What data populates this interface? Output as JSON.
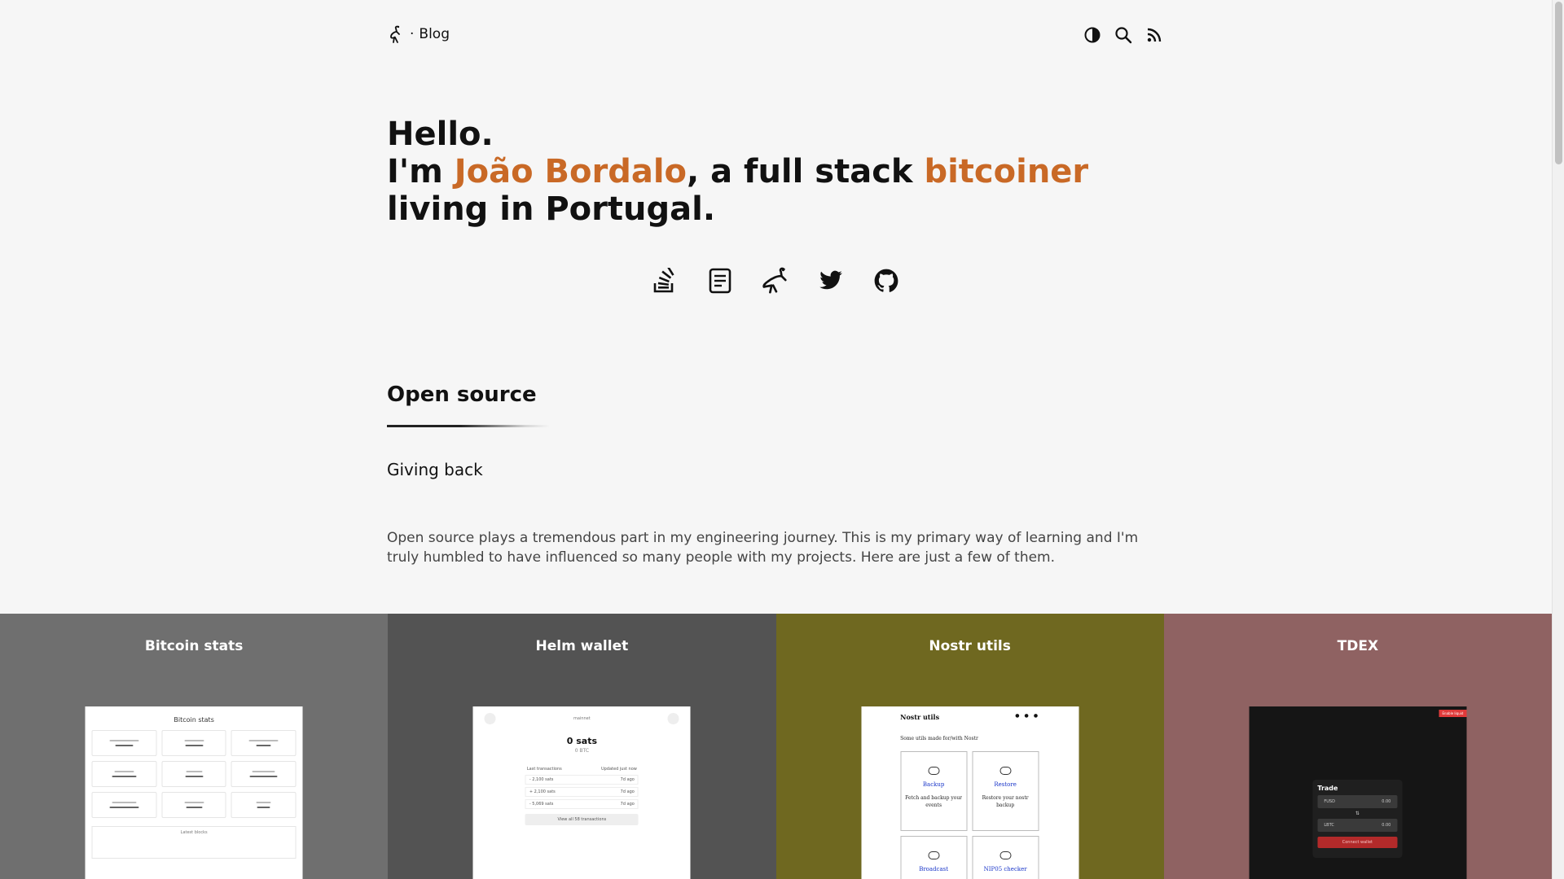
{
  "header": {
    "brand_logo_icon": "ostrich-mark-icon",
    "brand_separator": "·",
    "brand_label": "Blog",
    "actions": [
      {
        "icon": "theme-toggle-icon"
      },
      {
        "icon": "search-icon"
      },
      {
        "icon": "rss-icon"
      }
    ]
  },
  "hero": {
    "line1": "Hello.",
    "im": "I'm ",
    "name": "João Bordalo",
    "mid": ", a full stack ",
    "role": "bitcoiner",
    "line3": "living in Portugal.",
    "accent_color": "#c96926"
  },
  "socials": [
    {
      "icon": "stackoverflow-icon"
    },
    {
      "icon": "document-icon"
    },
    {
      "icon": "nostr-ostrich-icon"
    },
    {
      "icon": "twitter-icon"
    },
    {
      "icon": "github-icon"
    }
  ],
  "section": {
    "title": "Open source",
    "subtitle": "Giving back",
    "description": "Open source plays a tremendous part in my engineering journey. This is my primary way of learning and I'm truly humbled to have influenced so many people with my projects. Here are just a few of them."
  },
  "projects": [
    {
      "title": "Bitcoin stats",
      "color": "#6f6f6f",
      "preview": {
        "heading": "Bitcoin stats",
        "footer": "Latest blocks"
      }
    },
    {
      "title": "Helm wallet",
      "color": "#535353",
      "preview": {
        "network": "mainnet",
        "balance": "0 sats",
        "balance_btc": "0 BTC",
        "list_title": "Last transactions",
        "updated": "Updated just now",
        "rows": [
          {
            "amount": "- 2,100 sats",
            "when": "7d ago"
          },
          {
            "amount": "+ 2,100 sats",
            "when": "7d ago"
          },
          {
            "amount": "- 5,069 sats",
            "when": "7d ago"
          }
        ],
        "view_all": "View all 58 transactions"
      }
    },
    {
      "title": "Nostr utils",
      "color": "#6f6820",
      "preview": {
        "heading": "Nostr utils",
        "tagline": "Some utils made for/with Nostr",
        "tools": [
          {
            "name": "Backup",
            "desc": "Fetch and backup your events"
          },
          {
            "name": "Restore",
            "desc": "Restore your nostr backup"
          },
          {
            "name": "Broadcast",
            "desc": ""
          },
          {
            "name": "NIP05 checker",
            "desc": ""
          }
        ]
      }
    },
    {
      "title": "TDEX",
      "color": "#8f6262",
      "preview": {
        "badge": "Enable liquid",
        "heading": "Trade",
        "asset_from": "FUSD",
        "asset_from_val": "0.00",
        "asset_to": "LBTC",
        "asset_to_val": "0.00",
        "button": "Connect wallet"
      }
    }
  ]
}
